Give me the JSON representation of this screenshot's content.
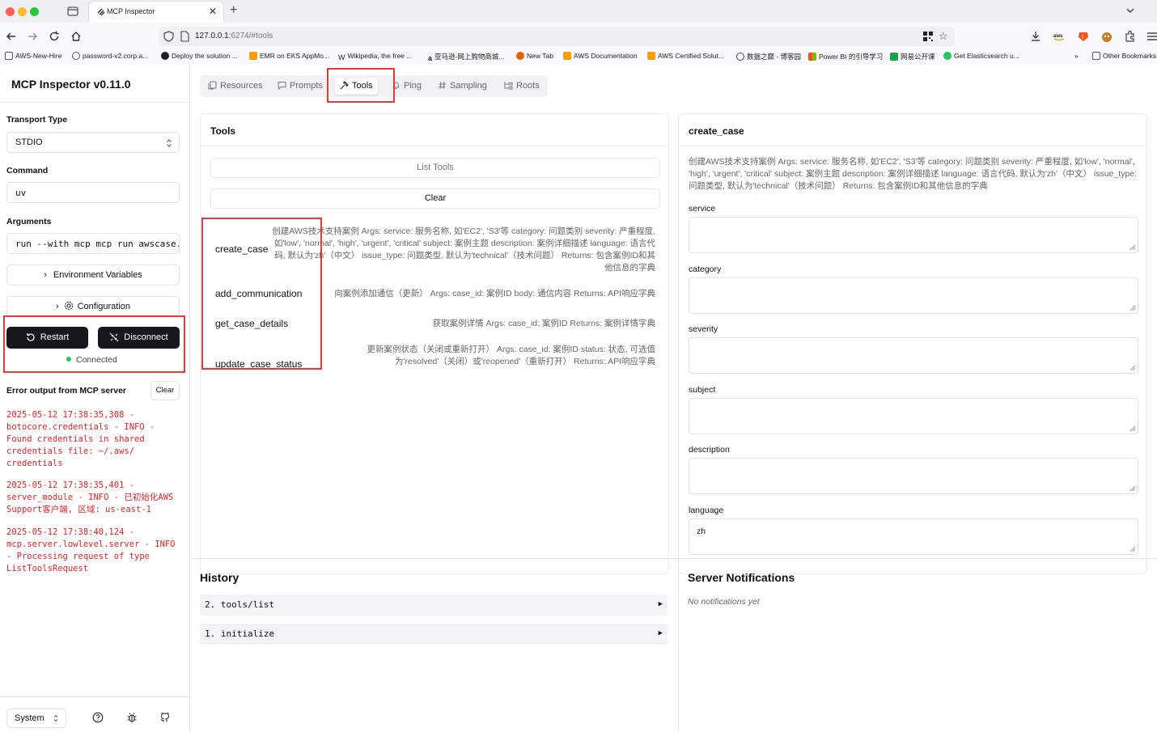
{
  "browser": {
    "tab_title": "MCP Inspector",
    "url_host": "127.0.0.1",
    "url_rest": ":6274/#tools",
    "bookmarks": [
      "AWS-New-Hire",
      "password-v2.corp.a...",
      "Deploy the solution ...",
      "EMR on EKS AppMo...",
      "Wikipedia, the free ...",
      "亚马逊-网上购物商城...",
      "New Tab",
      "AWS Documentation",
      "AWS Certified Solut...",
      "数据之巅 - 博客园",
      "Power BI 的引导学习",
      "网易公开课",
      "Get Elasticsearch u..."
    ],
    "other_bookmarks": "Other Bookmarks"
  },
  "sidebar": {
    "title": "MCP Inspector v0.11.0",
    "transport_label": "Transport Type",
    "transport_value": "STDIO",
    "command_label": "Command",
    "command_value": "uv",
    "arguments_label": "Arguments",
    "arguments_value": "run --with mcp mcp run awscase.",
    "env_button": "Environment Variables",
    "config_button": "Configuration",
    "restart_button": "Restart",
    "disconnect_button": "Disconnect",
    "status": "Connected",
    "error_title": "Error output from MCP server",
    "clear_button": "Clear",
    "error_logs": [
      "2025-05-12 17:38:35,308 - botocore.credentials - INFO - Found credentials in shared credentials file: ~/.aws/ credentials",
      "2025-05-12 17:38:35,401 - server_module - INFO - 已初始化AWS Support客户端, 区域: us-east-1",
      "2025-05-12 17:38:40,124 - mcp.server.lowlevel.server - INFO - Processing request of type ListToolsRequest"
    ],
    "theme": "System"
  },
  "tabs": [
    "Resources",
    "Prompts",
    "Tools",
    "Ping",
    "Sampling",
    "Roots"
  ],
  "tools_panel": {
    "title": "Tools",
    "list_button": "List Tools",
    "clear_button": "Clear",
    "tools": [
      {
        "name": "create_case",
        "desc": "创建AWS技术支持案例 Args: service: 服务名称, 如'EC2', 'S3'等 category: 问题类别 severity: 严重程度, 如'low', 'normal', 'high', 'urgent', 'critical' subject: 案例主题 description: 案例详细描述 language: 语言代码, 默认为'zh'（中文） issue_type: 问题类型, 默认为'technical'（技术问题） Returns: 包含案例ID和其他信息的字典"
      },
      {
        "name": "add_communication",
        "desc": "向案例添加通信（更新） Args: case_id: 案例ID body: 通信内容 Returns: API响应字典"
      },
      {
        "name": "get_case_details",
        "desc": "获取案例详情 Args: case_id: 案例ID Returns: 案例详情字典"
      },
      {
        "name": "update_case_status",
        "desc": "更新案例状态（关闭或重新打开） Args: case_id: 案例ID status: 状态, 可选值为'resolved'（关闭）或'reopened'（重新打开） Returns: API响应字典"
      }
    ]
  },
  "detail_panel": {
    "title": "create_case",
    "description": "创建AWS技术支持案例 Args: service: 服务名称, 如'EC2', 'S3'等 category: 问题类别 severity: 严重程度, 如'low', 'normal', 'high', 'urgent', 'critical' subject: 案例主题 description: 案例详细描述 language: 语言代码, 默认为'zh'（中文） issue_type: 问题类型, 默认为'technical'（技术问题） Returns: 包含案例ID和其他信息的字典",
    "fields": [
      {
        "label": "service",
        "value": ""
      },
      {
        "label": "category",
        "value": ""
      },
      {
        "label": "severity",
        "value": ""
      },
      {
        "label": "subject",
        "value": ""
      },
      {
        "label": "description",
        "value": ""
      },
      {
        "label": "language",
        "value": "zh"
      }
    ]
  },
  "history": {
    "title": "History",
    "items": [
      "2. tools/list",
      "1. initialize"
    ]
  },
  "notifications": {
    "title": "Server Notifications",
    "empty": "No notifications yet"
  },
  "colors": {
    "accent_dark": "#16181d",
    "error_red": "#dc2626",
    "connected_green": "#22c55e",
    "highlight_red": "#e53935"
  }
}
